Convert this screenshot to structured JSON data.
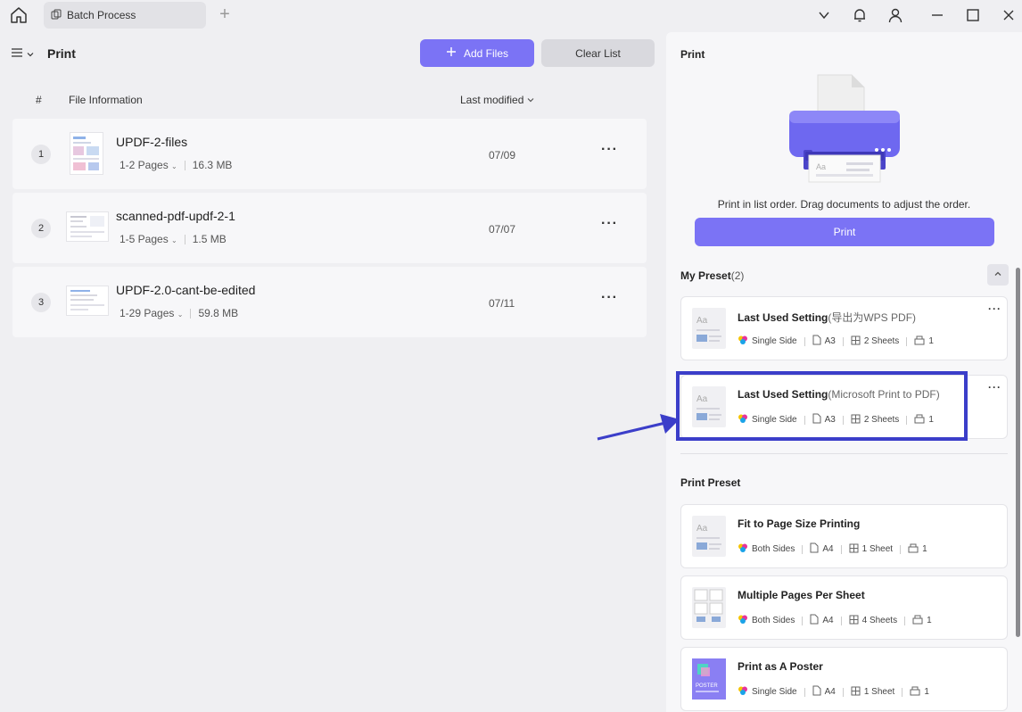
{
  "titlebar": {
    "tab_label": "Batch Process"
  },
  "left": {
    "title": "Print",
    "add_files_label": "Add Files",
    "clear_list_label": "Clear List",
    "col_number": "#",
    "col_file_info": "File Information",
    "col_last_modified": "Last modified",
    "files": [
      {
        "num": "1",
        "name": "UPDF-2-files",
        "pages": "1-2 Pages",
        "size": "16.3 MB",
        "date": "07/09"
      },
      {
        "num": "2",
        "name": "scanned-pdf-updf-2-1",
        "pages": "1-5 Pages",
        "size": "1.5 MB",
        "date": "07/07"
      },
      {
        "num": "3",
        "name": "UPDF-2.0-cant-be-edited",
        "pages": "1-29 Pages",
        "size": "59.8 MB",
        "date": "07/11"
      }
    ]
  },
  "right": {
    "print_label": "Print",
    "hint": "Print in list order. Drag documents to adjust the order.",
    "print_button": "Print",
    "my_preset_label": "My Preset",
    "my_preset_count": "(2)",
    "print_preset_label": "Print Preset",
    "my_presets": [
      {
        "title": "Last Used Setting",
        "sub": "(导出为WPS PDF)",
        "side": "Single Side",
        "paper": "A3",
        "sheets": "2 Sheets",
        "copies": "1"
      },
      {
        "title": "Last Used Setting",
        "sub": "(Microsoft Print to PDF)",
        "side": "Single Side",
        "paper": "A3",
        "sheets": "2 Sheets",
        "copies": "1"
      }
    ],
    "print_presets": [
      {
        "title": "Fit to Page Size Printing",
        "side": "Both Sides",
        "paper": "A4",
        "sheets": "1 Sheet",
        "copies": "1"
      },
      {
        "title": "Multiple Pages Per Sheet",
        "side": "Both Sides",
        "paper": "A4",
        "sheets": "4 Sheets",
        "copies": "1"
      },
      {
        "title": "Print as A Poster",
        "side": "Single Side",
        "paper": "A4",
        "sheets": "1 Sheet",
        "copies": "1"
      }
    ]
  },
  "colors": {
    "accent": "#7b73f5",
    "highlight": "#3b3ec9"
  }
}
